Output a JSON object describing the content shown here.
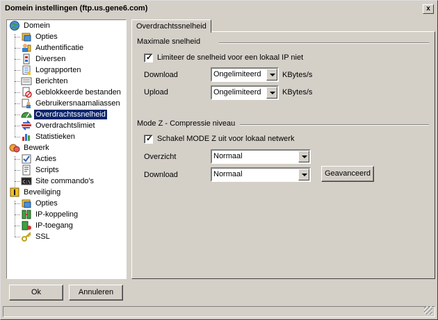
{
  "window": {
    "title": "Domein instellingen (ftp.us.gene6.com)",
    "close_label": "x"
  },
  "tree": {
    "domein": {
      "label": "Domein",
      "children": [
        "Opties",
        "Authentificatie",
        "Diversen",
        "Lograpporten",
        "Berichten",
        "Geblokkeerde bestanden",
        "Gebruikersnaamaliassen",
        "Overdrachtssnelheid",
        "Overdrachtslimiet",
        "Statistieken"
      ]
    },
    "bewerk": {
      "label": "Bewerk",
      "children": [
        "Acties",
        "Scripts",
        "Site commando's"
      ]
    },
    "beveiliging": {
      "label": "Beveiliging",
      "children": [
        "Opties",
        "IP-koppeling",
        "IP-toegang",
        "SSL"
      ]
    }
  },
  "buttons": {
    "ok": "Ok",
    "cancel": "Annuleren",
    "advanced": "Geavanceerd"
  },
  "tab": {
    "label": "Overdrachtssnelheid"
  },
  "speed_group": {
    "title": "Maximale snelheid",
    "checkbox_label": "Limiteer de snelheid voor een lokaal IP niet",
    "checked": true,
    "download_label": "Download",
    "download_value": "Ongelimiteerd",
    "upload_label": "Upload",
    "upload_value": "Ongelimiteerd",
    "unit": "KBytes/s"
  },
  "modez_group": {
    "title": "Mode Z - Compressie niveau",
    "checkbox_label": "Schakel MODE Z uit voor lokaal netwerk",
    "checked": true,
    "overview_label": "Overzicht",
    "overview_value": "Normaal",
    "download_label": "Download",
    "download_value": "Normaal"
  }
}
